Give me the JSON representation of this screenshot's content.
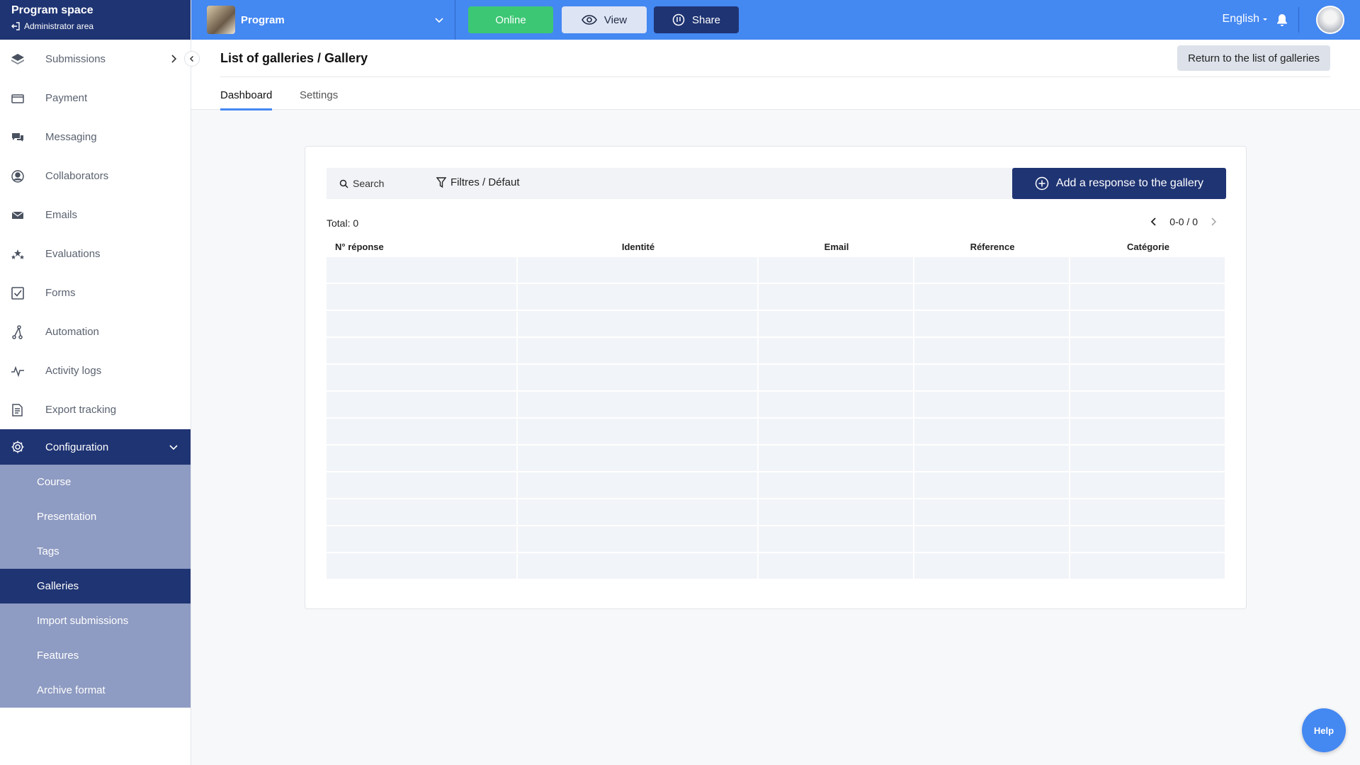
{
  "space": {
    "title": "Program space",
    "admin_link": "Administrator area"
  },
  "topbar": {
    "program_name": "Program",
    "online_label": "Online",
    "view_label": "View",
    "share_label": "Share",
    "language": "English"
  },
  "sidebar": {
    "items": [
      {
        "label": "Submissions",
        "icon": "layers-icon"
      },
      {
        "label": "Payment",
        "icon": "credit-card-icon"
      },
      {
        "label": "Messaging",
        "icon": "chat-icon"
      },
      {
        "label": "Collaborators",
        "icon": "user-circle-icon"
      },
      {
        "label": "Emails",
        "icon": "envelope-icon"
      },
      {
        "label": "Evaluations",
        "icon": "stars-icon"
      },
      {
        "label": "Forms",
        "icon": "checkbox-icon"
      },
      {
        "label": "Automation",
        "icon": "workflow-icon"
      },
      {
        "label": "Activity logs",
        "icon": "pulse-icon"
      },
      {
        "label": "Export tracking",
        "icon": "document-icon"
      }
    ],
    "config_label": "Configuration",
    "submenu": [
      {
        "label": "Course"
      },
      {
        "label": "Presentation"
      },
      {
        "label": "Tags"
      },
      {
        "label": "Galleries"
      },
      {
        "label": "Import submissions"
      },
      {
        "label": "Features"
      },
      {
        "label": "Archive format"
      }
    ]
  },
  "header": {
    "title": "List of galleries / Gallery",
    "return_label": "Return to the list of galleries",
    "tabs": [
      {
        "label": "Dashboard"
      },
      {
        "label": "Settings"
      }
    ]
  },
  "toolbar": {
    "search_label": "Search",
    "filter_label": "Filtres / Défaut",
    "add_label": "Add a response to the gallery"
  },
  "list": {
    "total": "Total: 0",
    "pager": "0-0 / 0",
    "columns": [
      "N° réponse",
      "Identité",
      "Email",
      "Réference",
      "Catégorie"
    ]
  },
  "help_label": "Help",
  "colors": {
    "primary": "#1f3473",
    "accent": "#4488f2",
    "success": "#3cc774",
    "submenu": "#8e9bc2"
  }
}
